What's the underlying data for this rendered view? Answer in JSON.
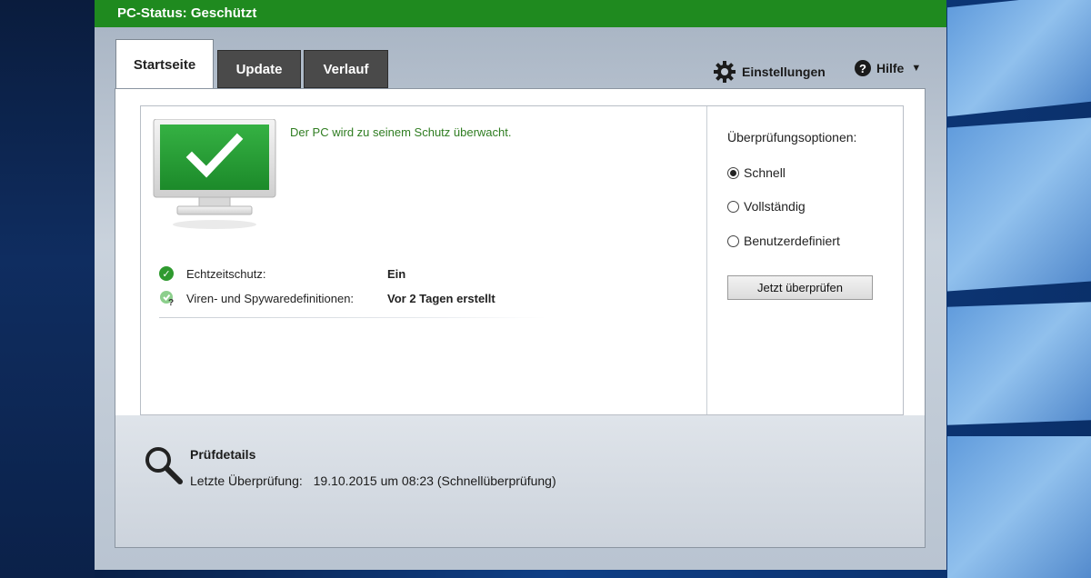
{
  "window": {
    "title": "PC-Status: Geschützt"
  },
  "tabs": [
    {
      "label": "Startseite",
      "active": true
    },
    {
      "label": "Update",
      "active": false
    },
    {
      "label": "Verlauf",
      "active": false
    }
  ],
  "toolbar": {
    "settings_label": "Einstellungen",
    "settings_icon": "gear-icon",
    "help_label": "Hilfe",
    "help_icon": "help-icon"
  },
  "status": {
    "message": "Der PC wird zu seinem Schutz überwacht.",
    "rows": [
      {
        "label": "Echtzeitschutz:",
        "value": "Ein",
        "icon": "check-icon"
      },
      {
        "label": "Viren- und Spywaredefinitionen:",
        "value": "Vor 2 Tagen erstellt",
        "icon": "definitions-question-icon"
      }
    ]
  },
  "scan_options": {
    "title": "Überprüfungsoptionen:",
    "options": [
      {
        "label": "Schnell",
        "selected": true
      },
      {
        "label": "Vollständig",
        "selected": false
      },
      {
        "label": "Benutzerdefiniert",
        "selected": false
      }
    ],
    "button_label": "Jetzt überprüfen"
  },
  "details": {
    "title": "Prüfdetails",
    "last_scan_label": "Letzte Überprüfung:",
    "last_scan_value": "19.10.2015 um 08:23 (Schnellüberprüfung)"
  },
  "colors": {
    "titlebar": "#1f8a1f",
    "status_text": "#2f7d21",
    "monitor_screen": "#2a9a35"
  }
}
